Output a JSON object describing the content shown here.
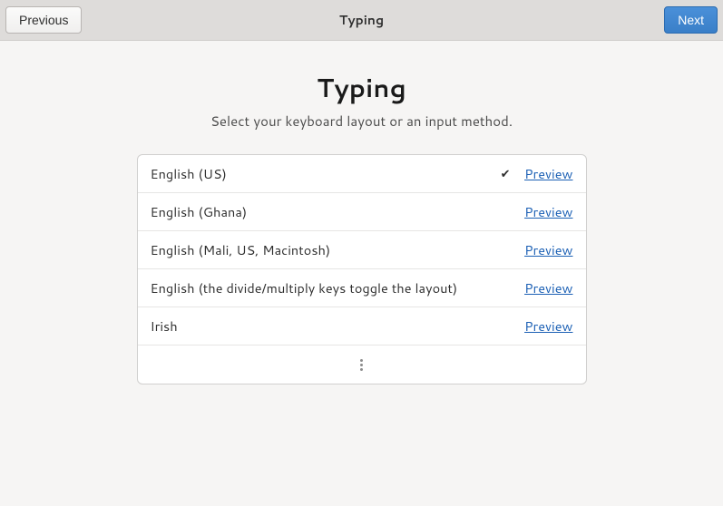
{
  "header": {
    "previous_label": "Previous",
    "title": "Typing",
    "next_label": "Next"
  },
  "page": {
    "title": "Typing",
    "subtitle": "Select your keyboard layout or an input method."
  },
  "layouts": [
    {
      "label": "English (US)",
      "selected": true,
      "preview_label": "Preview"
    },
    {
      "label": "English (Ghana)",
      "selected": false,
      "preview_label": "Preview"
    },
    {
      "label": "English (Mali, US, Macintosh)",
      "selected": false,
      "preview_label": "Preview"
    },
    {
      "label": "English (the divide/multiply keys toggle the layout)",
      "selected": false,
      "preview_label": "Preview"
    },
    {
      "label": "Irish",
      "selected": false,
      "preview_label": "Preview"
    }
  ]
}
